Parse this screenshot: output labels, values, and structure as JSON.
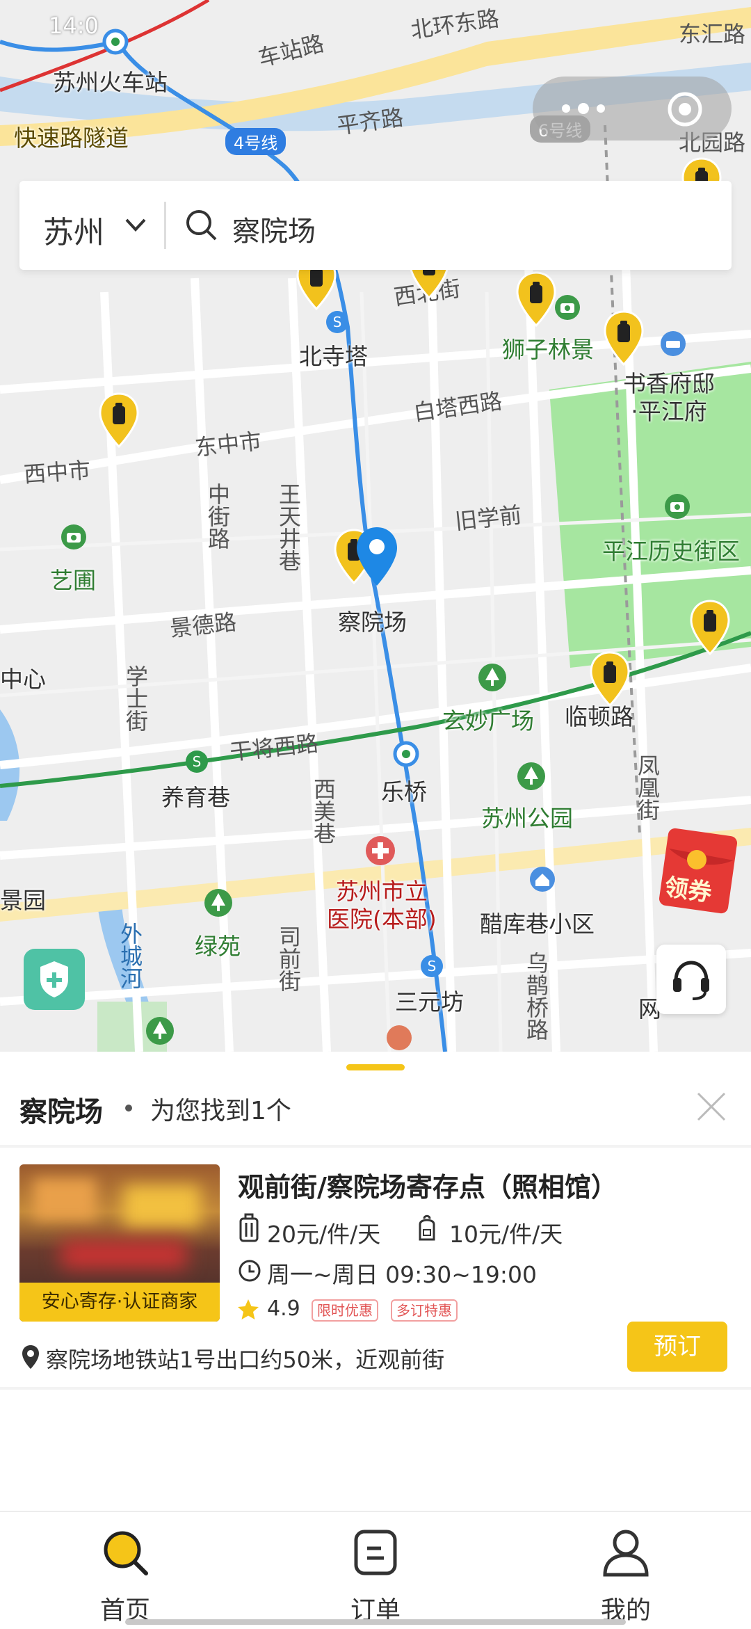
{
  "map": {
    "labels": {
      "suzhou_station": "苏州火车站",
      "express_tunnel": "快速路隧道",
      "chezhan_road": "车站路",
      "pingqi_road": "平齐路",
      "beihuan_east": "北环东路",
      "dong_hui_road": "东汇路",
      "beiyuan_road": "北园路",
      "xibei_street": "西北街",
      "beisita": "北寺塔",
      "shizilin": "狮子林景",
      "shuxiang": "书香府邸\n·平江府",
      "baita_west": "白塔西路",
      "dongzhongshi": "东中市",
      "xizhongshi": "西中市",
      "zhongjie_road": "中街路",
      "wangtianjing": "王天井巷",
      "jiuxueqian": "旧学前",
      "pingjiang": "平江历史街区",
      "yipu": "艺圃",
      "jingde_road": "景德路",
      "chayuanchang": "察院场",
      "center": "中心",
      "xueshi": "学士街",
      "xuanmiao": "玄妙广场",
      "lindun": "临顿路",
      "ganjiang": "干将西路",
      "yangyu": "养育巷",
      "leqiao": "乐桥",
      "ximei": "西美巷",
      "suzhou_park": "苏州公园",
      "fenghuang": "凤凰街",
      "jingyuan": "景园",
      "hospital": "苏州市立\n医院(本部)",
      "cuku": "醋库巷小区",
      "waicheng": "外城河",
      "lvyuan": "绿苑",
      "siqian": "司前街",
      "sanyuanfang": "三元坊",
      "wuque": "乌鹊桥路",
      "wang": "网"
    },
    "line_badges": {
      "line4": "4号线",
      "line6": "6号线"
    },
    "status_time": "14:0"
  },
  "search": {
    "city": "苏州",
    "query": "察院场"
  },
  "coupon": {
    "label": "领券"
  },
  "sheet": {
    "title": "察院场",
    "count_text": "为您找到1个"
  },
  "store": {
    "name": "观前街/察院场寄存点（照相馆）",
    "badge": "安心寄存·认证商家",
    "price_large": "20元/件/天",
    "price_small": "10元/件/天",
    "hours": "周一~周日 09:30~19:00",
    "rating": "4.9",
    "tags": [
      "限时优惠",
      "多订特惠"
    ],
    "address": "察院场地铁站1号出口约50米，近观前街",
    "book_label": "预订"
  },
  "nav": {
    "items": [
      {
        "label": "首页",
        "icon": "search-icon"
      },
      {
        "label": "订单",
        "icon": "order-icon"
      },
      {
        "label": "我的",
        "icon": "profile-icon"
      }
    ]
  },
  "colors": {
    "accent": "#f5c518",
    "metro_line": "#2f7de1",
    "pin_blue": "#1e88e5",
    "green_area": "#9fe39a"
  }
}
